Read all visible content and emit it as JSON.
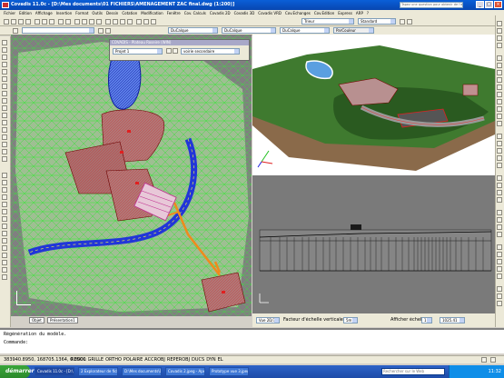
{
  "window": {
    "title": "Covadis 11.0c - [D:\\Mes documents\\01 FICHIERS\\AMENAGEMENT ZAC final.dwg (1:200)]",
    "help_search_placeholder": "Tapez une question pour obtenir de l'aide"
  },
  "menu": [
    "Fichier",
    "Edition",
    "Affichage",
    "Insertion",
    "Format",
    "Outils",
    "Dessin",
    "Cotation",
    "Modification",
    "Fenêtre",
    "Cov. Calculs",
    "Covadis 2D",
    "Covadis 3D",
    "Covadis VRD",
    "Cov.Echanges",
    "Cov.Edition",
    "Express",
    "ARP",
    "?"
  ],
  "toolbar": {
    "layer_value": "Trieur",
    "style_value": "Standard",
    "color_value": "DuCalque",
    "linetype_value": "DuCalque",
    "lineweight_value": "DuCalque",
    "plotstyle_value": "ParCouleur"
  },
  "layer_window": {
    "title": "COVADIS - Plateau Roseire (WIN)",
    "project_value": "Projet 1",
    "view_value": "voirie secondaire"
  },
  "layout_tabs": [
    "Objet",
    "Présentation1"
  ],
  "profile_bar": {
    "view_dropdown": "Vue 2D/3D",
    "scale_label": "Facteur d'échelle verticale",
    "scale_value": "5m",
    "zoom_label": "Afficher échelle",
    "zoom_value": "1",
    "coord_value": "1025.41"
  },
  "command": {
    "history": "Régénération du modèle.",
    "prompt": "Commande:"
  },
  "status": {
    "coords": "383940.8950, 168705.1364, 0.0000",
    "toggles": [
      "RESOL",
      "GRILLE",
      "ORTHO",
      "POLAIRE",
      "ACCROBJ",
      "REPEROBJ",
      "DUCS",
      "DYN",
      "EL"
    ]
  },
  "taskbar": {
    "start_label": "démarrer",
    "tasks": [
      "Covadis 11.0c - [D:\\...",
      "2 Explorateur de fichier",
      "D:\\Mes documents\\01...",
      "Covadis 2.jpeg - Aperç...",
      "Prototype vue 3.jpeg"
    ],
    "search_placeholder": "Rechercher sur le Web",
    "clock": "11:32"
  },
  "colors": {
    "terrain_green": "#b6f2a0",
    "mesh_green": "#3ce03c",
    "road_blue": "#2236d8",
    "building_brown": "#b07878",
    "lake_blue": "#5b7fe8",
    "profile_gray": "#7a7a7a"
  }
}
